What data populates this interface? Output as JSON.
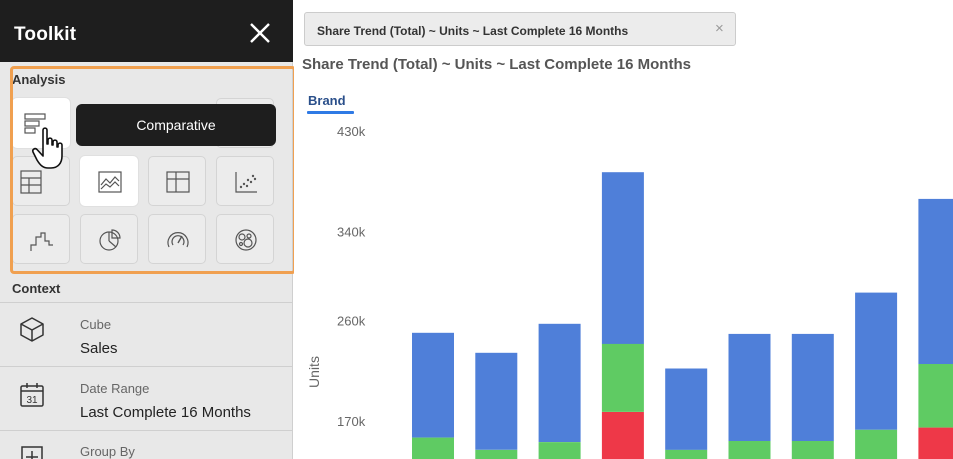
{
  "toolkit": {
    "title": "Toolkit",
    "analysis_label": "Analysis",
    "tooltip": "Comparative",
    "context_label": "Context",
    "tiles": [
      {
        "name": "comparative",
        "icon": "horizontal-bar-chart-icon",
        "selected": false
      },
      {
        "name": "stacked-table",
        "icon": "stacked-table-icon",
        "selected": false
      },
      {
        "name": "trend-line",
        "icon": "trend-line-chart-icon",
        "selected": true
      },
      {
        "name": "cross-tab",
        "icon": "crosstab-grid-icon",
        "selected": false
      },
      {
        "name": "scatter",
        "icon": "scatter-plot-icon",
        "selected": false
      },
      {
        "name": "step",
        "icon": "step-chart-icon",
        "selected": false
      },
      {
        "name": "pie",
        "icon": "pie-chart-icon",
        "selected": false
      },
      {
        "name": "gauge",
        "icon": "gauge-icon",
        "selected": false
      },
      {
        "name": "map",
        "icon": "bubble-map-icon",
        "selected": false
      }
    ],
    "context": {
      "cube": {
        "label": "Cube",
        "value": "Sales",
        "icon": "cube-icon"
      },
      "date_range": {
        "label": "Date Range",
        "value": "Last Complete 16 Months",
        "icon": "calendar-icon",
        "calendar_day": "31"
      },
      "group_by": {
        "label": "Group By",
        "icon": "group-by-icon"
      }
    }
  },
  "tab": {
    "label": "Share Trend (Total) ~ Units ~ Last Complete 16 Months",
    "close": "×"
  },
  "report": {
    "title": "Share Trend (Total) ~ Units ~ Last Complete 16 Months",
    "brand_label": "Brand"
  },
  "colors": {
    "blue": "#4f7fd9",
    "green": "#5fcb63",
    "red": "#ee3848",
    "highlight": "#f0a050"
  },
  "chart_data": {
    "type": "bar",
    "stacked": true,
    "ylabel": "Units",
    "yticks": [
      "430k",
      "340k",
      "260k",
      "170k"
    ],
    "ytick_values": [
      430000,
      340000,
      260000,
      170000
    ],
    "ylim_visible": [
      145000,
      430000
    ],
    "series": [
      {
        "color": "blue",
        "top_values": [
          250000,
          232000,
          258000,
          394000,
          218000,
          249000,
          249000,
          286000,
          370000
        ]
      },
      {
        "color": "green",
        "top_values": [
          156000,
          145000,
          152000,
          240000,
          145000,
          153000,
          153000,
          163000,
          222000
        ]
      },
      {
        "color": "red",
        "top_values": [
          null,
          null,
          null,
          179000,
          null,
          null,
          null,
          null,
          165000
        ]
      }
    ]
  }
}
